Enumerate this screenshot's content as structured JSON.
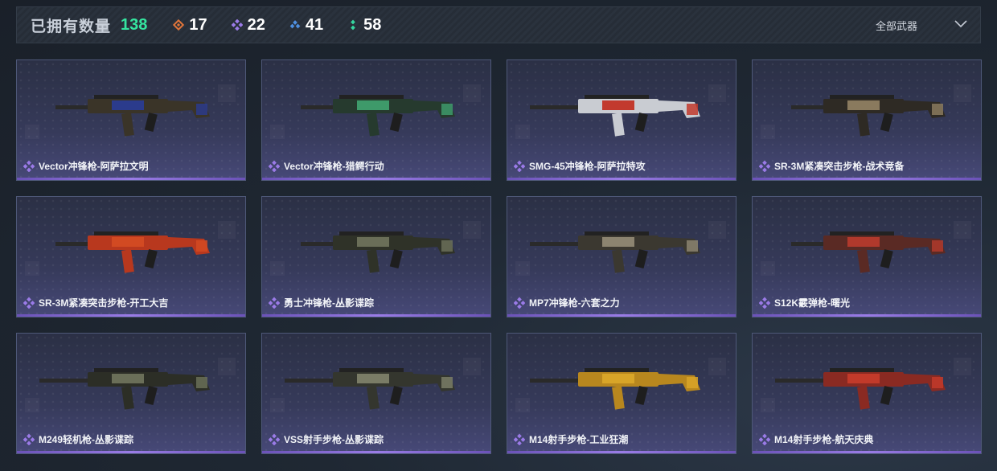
{
  "header": {
    "owned_label": "已拥有数量",
    "owned_count": "138",
    "rarities": [
      {
        "icon": "orange-diamond-icon",
        "count": "17",
        "color": "#e0753a"
      },
      {
        "icon": "purple-diamond-icon",
        "count": "22",
        "color": "#9b7be8"
      },
      {
        "icon": "blue-diamond-icon",
        "count": "41",
        "color": "#4e8fe0"
      },
      {
        "icon": "green-dots-icon",
        "count": "58",
        "color": "#35d6a0"
      }
    ],
    "filter_label": "全部武器"
  },
  "cards": [
    {
      "name": "Vector冲锋枪-阿萨拉文明",
      "rarity_icon": "purple-diamond-icon",
      "accent": "#2b3b8c",
      "body": "#3a3428"
    },
    {
      "name": "Vector冲锋枪-猎鳄行动",
      "rarity_icon": "purple-diamond-icon",
      "accent": "#3e9a6a",
      "body": "#263a2e"
    },
    {
      "name": "SMG-45冲锋枪-阿萨拉特攻",
      "rarity_icon": "purple-diamond-icon",
      "accent": "#c23a2e",
      "body": "#c9ccd2"
    },
    {
      "name": "SR-3M紧凑突击步枪-战术竞备",
      "rarity_icon": "purple-diamond-icon",
      "accent": "#8a7a5e",
      "body": "#2e2a24"
    },
    {
      "name": "SR-3M紧凑突击步枪-开工大吉",
      "rarity_icon": "purple-diamond-icon",
      "accent": "#d24a22",
      "body": "#b8381e"
    },
    {
      "name": "勇士冲锋枪-丛影谍踪",
      "rarity_icon": "purple-diamond-icon",
      "accent": "#6a6e58",
      "body": "#2f3228"
    },
    {
      "name": "MP7冲锋枪-六套之力",
      "rarity_icon": "purple-diamond-icon",
      "accent": "#8c8470",
      "body": "#3b3830"
    },
    {
      "name": "S12K霰弹枪-曙光",
      "rarity_icon": "purple-diamond-icon",
      "accent": "#b0392c",
      "body": "#5a2a24"
    },
    {
      "name": "M249轻机枪-丛影谍踪",
      "rarity_icon": "purple-diamond-icon",
      "accent": "#6a6e58",
      "body": "#2c2e26"
    },
    {
      "name": "VSS射手步枪-丛影谍踪",
      "rarity_icon": "purple-diamond-icon",
      "accent": "#7a7c66",
      "body": "#34362e"
    },
    {
      "name": "M14射手步枪-工业狂潮",
      "rarity_icon": "purple-diamond-icon",
      "accent": "#d8a528",
      "body": "#b8871e"
    },
    {
      "name": "M14射手步枪-航天庆典",
      "rarity_icon": "purple-diamond-icon",
      "accent": "#c23a2a",
      "body": "#8a2a22"
    }
  ]
}
